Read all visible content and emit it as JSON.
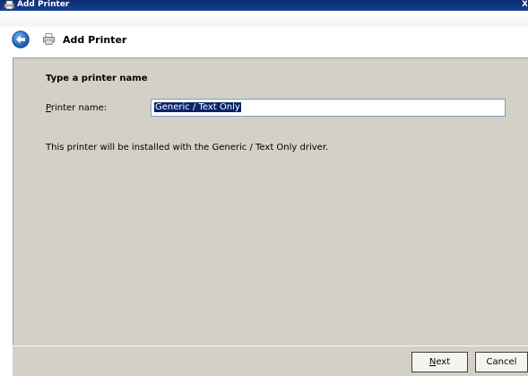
{
  "window": {
    "title": "Add Printer"
  },
  "header": {
    "title": "Add Printer"
  },
  "form": {
    "section_heading": "Type a printer name",
    "printer_name_label_mnemonic": "P",
    "printer_name_label_rest": "rinter name:",
    "printer_name_value": "Generic / Text Only",
    "info_text": "This printer will be installed with the Generic / Text Only driver."
  },
  "footer": {
    "next_label_mnemonic": "N",
    "next_label_rest": "ext",
    "cancel_label": "Cancel"
  },
  "colors": {
    "titlebar": "#10337a",
    "content_bg": "#d4d0c8",
    "selection": "#0a246a",
    "back_button": "#2a73c8"
  },
  "icons": {
    "title": "printer-add-icon",
    "back": "back-arrow-icon",
    "header": "printer-icon",
    "close": "close-icon"
  }
}
